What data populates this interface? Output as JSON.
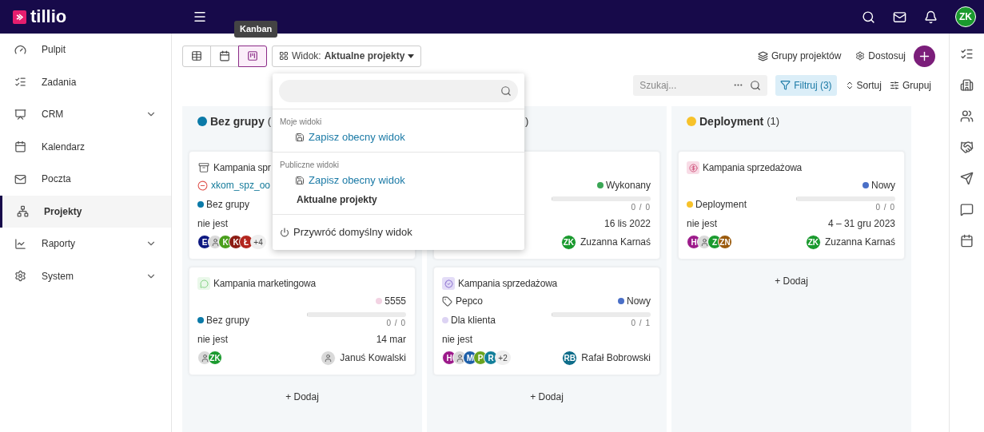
{
  "brand": {
    "name": "tillio"
  },
  "tooltip": "Kanban",
  "user": {
    "initials": "ZK"
  },
  "sidebar": {
    "items": [
      {
        "label": "Pulpit",
        "selected": false,
        "expandable": false
      },
      {
        "label": "Zadania",
        "selected": false,
        "expandable": false
      },
      {
        "label": "CRM",
        "selected": false,
        "expandable": true
      },
      {
        "label": "Kalendarz",
        "selected": false,
        "expandable": false
      },
      {
        "label": "Poczta",
        "selected": false,
        "expandable": false
      },
      {
        "label": "Projekty",
        "selected": true,
        "expandable": false
      },
      {
        "label": "Raporty",
        "selected": false,
        "expandable": true
      },
      {
        "label": "System",
        "selected": false,
        "expandable": true
      }
    ]
  },
  "view_switch": [
    {
      "kind": "table",
      "selected": false
    },
    {
      "kind": "calendar",
      "selected": false
    },
    {
      "kind": "kanban",
      "selected": true
    }
  ],
  "view_select": {
    "label": "Widok:",
    "value": "Aktualne projekty"
  },
  "actions": [
    "Grupy projektów",
    "Dostosuj"
  ],
  "search": {
    "placeholder": "Szukaj..."
  },
  "filter": {
    "label": "Filtruj (3)",
    "active": true
  },
  "sort": "Sortuj",
  "group": "Grupuj",
  "dropdown": {
    "sections": [
      {
        "title": "Moje widoki",
        "items": [
          {
            "kind": "save",
            "label": "Zapisz obecny widok"
          }
        ]
      },
      {
        "title": "Publiczne widoki",
        "items": [
          {
            "kind": "save",
            "label": "Zapisz obecny widok"
          },
          {
            "kind": "view",
            "label": "Aktualne projekty"
          }
        ]
      }
    ],
    "reset": "Przywróć domyślny widok"
  },
  "columns": [
    {
      "name": "Bez grupy",
      "count": "(",
      "color": "#0b7aa8",
      "add": "+ Dodaj",
      "cards": [
        {
          "kind": "archive",
          "title": "Kampania spr",
          "tag": {
            "kind": "client",
            "text": "xkom_spz_oo"
          },
          "group": {
            "label": "Bez grupy",
            "color": "#0b7aa8"
          },
          "note": "nie jest",
          "members": [
            {
              "initials": "E",
              "color": "#0d1880"
            },
            {
              "kind": "photo"
            },
            {
              "initials": "K",
              "color": "#4a9e1c"
            },
            {
              "initials": "K",
              "color": "#8c1c13"
            },
            {
              "initials": "Ł",
              "color": "#b3261e"
            }
          ],
          "extra": "+4"
        },
        {
          "kind": "chat",
          "title": "Kampania marketingowa",
          "status": {
            "label": "5555",
            "color": "#f3d3e3"
          },
          "group": {
            "label": "Bez grupy",
            "color": "#0b7aa8"
          },
          "progress": {
            "level": 0,
            "reading": "0 / 0"
          },
          "note": "nie jest",
          "date": "14 mar",
          "members": [
            {
              "kind": "photo"
            },
            {
              "initials": "ZK",
              "color": "#1a9a2e"
            }
          ],
          "owner": {
            "kind": "photo",
            "name": "Januś Kowalski"
          }
        }
      ]
    },
    {
      "count": ")",
      "add": "+ Dodaj",
      "cards": [
        {
          "status": {
            "label": "Wykonany",
            "color": "#3aa655"
          },
          "progress": {
            "level": 0,
            "reading": "0 / 0"
          },
          "date": "16 lis 2022",
          "owner": {
            "initials": "ZK",
            "color": "#1a9a2e",
            "name": "Zuzanna Karnaś"
          }
        },
        {
          "kind": "badge",
          "title": "Kampania sprzedażowa",
          "tag": {
            "kind": "label",
            "text": "Pepco"
          },
          "status": {
            "label": "Nowy",
            "color": "#4a6fc7"
          },
          "group": {
            "label": "Dla klienta",
            "color": "#dcd3f3"
          },
          "progress": {
            "level": 0,
            "reading": "0 / 1"
          },
          "note": "nie jest",
          "members": [
            {
              "initials": "H",
              "color": "#9c1a8a"
            },
            {
              "kind": "photo"
            },
            {
              "initials": "M",
              "color": "#1d5fa8"
            },
            {
              "initials": "P",
              "color": "#6aa31f"
            },
            {
              "initials": "R",
              "color": "#137f9a"
            }
          ],
          "extra": "+2",
          "owner": {
            "initials": "RB",
            "color": "#0e6d8a",
            "name": "Rafał Bobrowski"
          }
        }
      ]
    },
    {
      "name": "Deployment",
      "count": "(1)",
      "color": "#f7c22a",
      "add": "+ Dodaj",
      "cards": [
        {
          "kind": "money",
          "title": "Kampania sprzedażowa",
          "status": {
            "label": "Nowy",
            "color": "#4a6fc7"
          },
          "group": {
            "label": "Deployment",
            "color": "#f7c22a"
          },
          "progress": {
            "level": 0,
            "reading": "0 / 0"
          },
          "note": "nie jest",
          "date": "4 – 31 gru 2023",
          "members": [
            {
              "initials": "H",
              "color": "#9c1a8a"
            },
            {
              "kind": "photo"
            },
            {
              "initials": "Z",
              "color": "#1a9a2e"
            },
            {
              "initials": "ZN",
              "color": "#9a5a0c"
            }
          ],
          "owner": {
            "initials": "ZK",
            "color": "#1a9a2e",
            "name": "Zuzanna Karnaś"
          }
        }
      ]
    }
  ]
}
